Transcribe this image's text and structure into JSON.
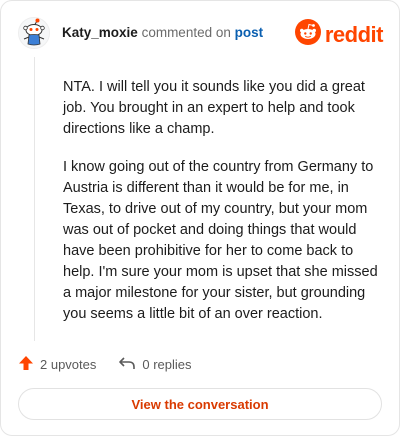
{
  "header": {
    "username": "Katy_moxie",
    "action_text": "commented on",
    "post_link": "post",
    "avatar_icon": "snoo-avatar-icon"
  },
  "brand": {
    "name": "reddit",
    "color": "#ff4500",
    "icon": "reddit-logo-icon"
  },
  "comment": {
    "paragraphs": [
      "NTA. I will tell you it sounds like you did a great job. You brought in an expert to help and took directions like a champ.",
      "I know going out of the country from Germany to Austria is different than it would be for me, in Texas, to drive out of my country, but your mom was out of pocket and doing things that would have been prohibitive for her to come back to help. I'm sure your mom is upset that she missed a major milestone for your sister, but grounding you seems a little bit of an over reaction."
    ]
  },
  "actions": {
    "upvotes": "2 upvotes",
    "upvote_icon": "upvote-arrow-icon",
    "replies": "0 replies",
    "reply_icon": "reply-arrow-icon"
  },
  "cta": {
    "label": "View the conversation",
    "color": "#d93a00"
  }
}
